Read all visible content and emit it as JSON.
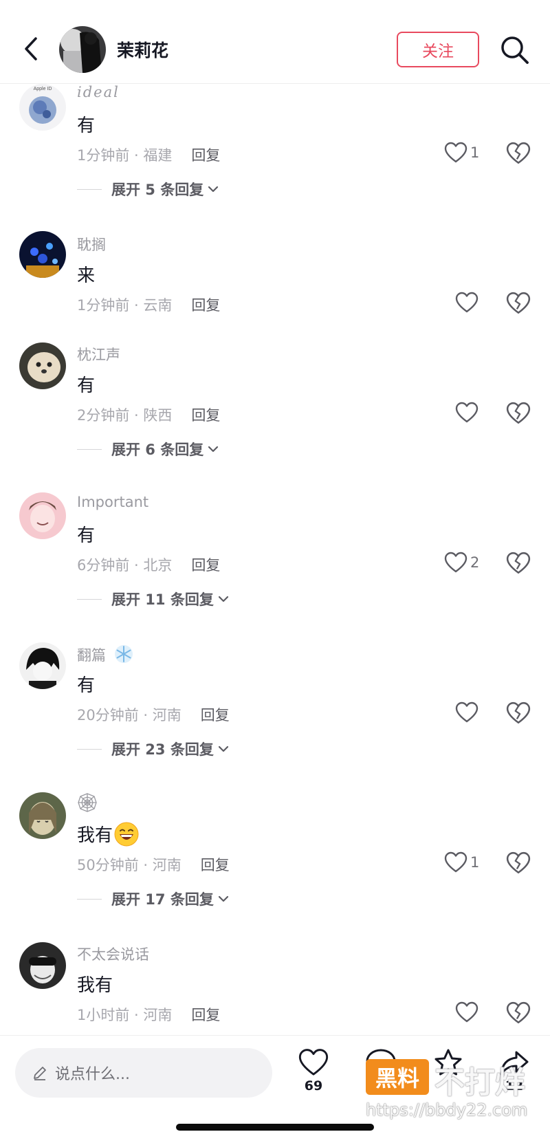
{
  "header": {
    "username": "茉莉花",
    "follow_label": "关注"
  },
  "comments": [
    {
      "name": "ideal",
      "avatar_badge": "Apple ID",
      "text": "有",
      "time_location": "1分钟前 · 福建",
      "reply_label": "回复",
      "likes": "1",
      "expand_label": "展开 5 条回复"
    },
    {
      "name": "耽搁",
      "text": "来",
      "time_location": "1分钟前 · 云南",
      "reply_label": "回复",
      "likes": ""
    },
    {
      "name": "枕江声",
      "text": "有",
      "time_location": "2分钟前 · 陕西",
      "reply_label": "回复",
      "likes": "",
      "expand_label": "展开 6 条回复"
    },
    {
      "name": "Important",
      "text": "有",
      "time_location": "6分钟前 · 北京",
      "reply_label": "回复",
      "likes": "2",
      "expand_label": "展开 11 条回复"
    },
    {
      "name": "翻篇",
      "name_emoji": "snowflake",
      "text": "有",
      "time_location": "20分钟前 · 河南",
      "reply_label": "回复",
      "likes": "",
      "expand_label": "展开 23 条回复"
    },
    {
      "name": "",
      "name_icon": "spiderweb",
      "text": "我有",
      "text_emoji": "grinning-face",
      "time_location": "50分钟前 · 河南",
      "reply_label": "回复",
      "likes": "1",
      "expand_label": "展开 17 条回复"
    },
    {
      "name": "不太会说话",
      "text": "我有",
      "time_location": "1小时前 · 河南",
      "reply_label": "回复",
      "likes": ""
    }
  ],
  "bottom_bar": {
    "input_placeholder": "说点什么...",
    "likes_count": "69",
    "comments_count": "",
    "favorites_count": "",
    "shares_count": "12"
  },
  "watermark": {
    "badge": "黑料",
    "text": "不打烊",
    "url": "https://bbdy22.com"
  },
  "colors": {
    "accent": "#e8495e",
    "text_primary": "#161823",
    "text_secondary": "#a7a7ad",
    "watermark_orange": "#f28c1c"
  }
}
